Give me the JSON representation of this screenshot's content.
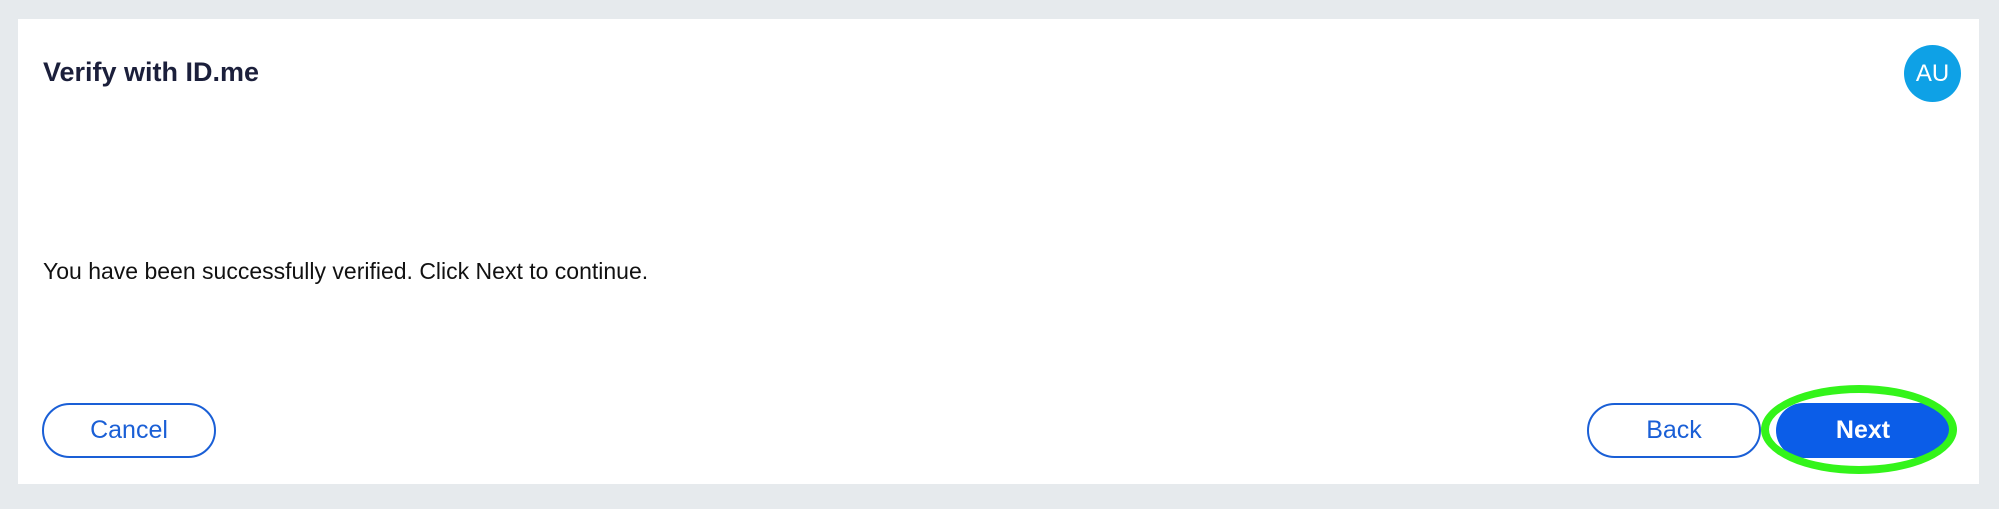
{
  "header": {
    "title": "Verify with ID.me",
    "avatar_initials": "AU"
  },
  "main": {
    "message": "You have been successfully verified. Click Next to continue."
  },
  "footer": {
    "cancel_label": "Cancel",
    "back_label": "Back",
    "next_label": "Next"
  },
  "colors": {
    "primary": "#0b5de8",
    "outline": "#1a5fd6",
    "avatar": "#0ea1e6",
    "highlight": "#33f41a",
    "page_bg": "#e6eaed"
  }
}
